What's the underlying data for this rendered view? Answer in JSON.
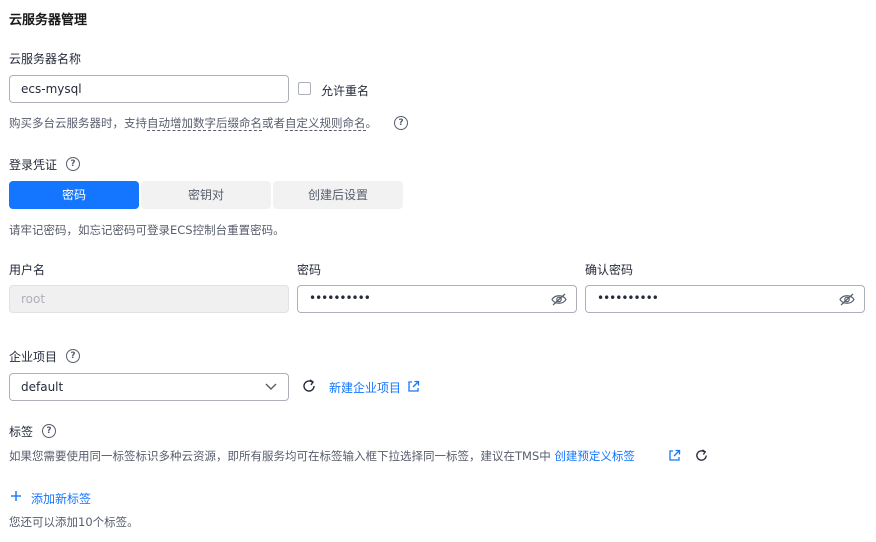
{
  "section": {
    "title": "云服务器管理"
  },
  "name": {
    "label": "云服务器名称",
    "value": "ecs-mysql",
    "allow_duplicate_label": "允许重名",
    "hint_prefix": "购买多台云服务器时，支持",
    "hint_link1": "自动增加数字后缀命名",
    "hint_middle": "或者",
    "hint_link2": "自定义规则命名",
    "hint_suffix": "。"
  },
  "login": {
    "label": "登录凭证",
    "tabs": [
      {
        "label": "密码",
        "active": true
      },
      {
        "label": "密钥对",
        "active": false
      },
      {
        "label": "创建后设置",
        "active": false
      }
    ],
    "hint": "请牢记密码，如忘记密码可登录ECS控制台重置密码。",
    "username_label": "用户名",
    "username_value": "root",
    "password_label": "密码",
    "password_value": "••••••••••",
    "confirm_label": "确认密码",
    "confirm_value": "••••••••••"
  },
  "enterprise": {
    "label": "企业项目",
    "selected": "default",
    "new_link": "新建企业项目"
  },
  "tags": {
    "label": "标签",
    "desc_prefix": "如果您需要使用同一标签标识多种云资源，即所有服务均可在标签输入框下拉选择同一标签，建议在TMS中",
    "create_link": "创建预定义标签",
    "add_label": "添加新标签",
    "remaining": "您还可以添加10个标签。"
  },
  "colors": {
    "accent": "#1476ff",
    "text": "#252b3a",
    "muted": "#575d6c"
  },
  "icons": [
    "question-icon",
    "eye-off-icon",
    "chevron-down-icon",
    "refresh-icon",
    "external-link-icon",
    "plus-icon"
  ]
}
